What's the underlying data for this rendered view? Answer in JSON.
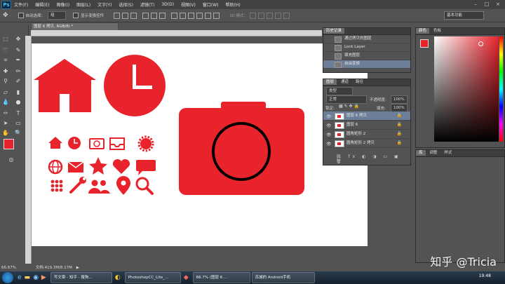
{
  "app": {
    "logo_text": "Ps"
  },
  "menu": [
    "文件(F)",
    "编辑(E)",
    "图像(I)",
    "图层(L)",
    "文字(Y)",
    "选择(S)",
    "滤镜(T)",
    "3D(D)",
    "视图(V)",
    "窗口(W)",
    "帮助(H)"
  ],
  "window_controls": [
    "–",
    "□",
    "×"
  ],
  "options_bar": {
    "auto_select_label": "自动选择：",
    "auto_select_value": "组",
    "show_transform_label": "显示变换控件",
    "mode_3d_label": "3D 模式：",
    "workspace": "基本功能"
  },
  "document": {
    "tab_title": "图层 6 拷贝, RGB/8) *",
    "zoom": "66.67%",
    "doc_info": "文档:419.3M/8.17M"
  },
  "history_panel": {
    "tab": "历史记录",
    "items": [
      {
        "label": "通过拷贝的图层",
        "selected": false
      },
      {
        "label": "Lock Layer",
        "selected": false
      },
      {
        "label": "填充图层",
        "selected": false
      },
      {
        "label": "自由变换",
        "selected": true
      }
    ]
  },
  "layers_panel": {
    "tabs": [
      "图层",
      "通道",
      "路径"
    ],
    "filter_label": "类型",
    "blend_mode": "正常",
    "opacity_label": "不透明度:",
    "opacity_value": "100%",
    "lock_label": "锁定:",
    "fill_label": "填充:",
    "fill_value": "100%",
    "layers": [
      {
        "name": "图层 6 拷贝",
        "selected": true
      },
      {
        "name": "图层 6",
        "selected": false
      },
      {
        "name": "圆角矩形 2",
        "selected": false
      },
      {
        "name": "圆角矩形 2 拷贝",
        "selected": false
      }
    ]
  },
  "color_panel": {
    "tabs": [
      "颜色",
      "色板"
    ],
    "colors": {
      "foreground": "#e8232c",
      "accent": "#e8232c"
    }
  },
  "adjust_panel": {
    "tabs": [
      "库",
      "调整",
      "样式"
    ]
  },
  "taskbar": {
    "tasks": [
      "写文章 - 知乎 - 搜狗...",
      "PhotoshopCC_Lite_...",
      "66.7% (图层 6 ...",
      "苏城的 Android手机"
    ],
    "clock": "19:48"
  },
  "watermark": "知乎 @Tricia"
}
